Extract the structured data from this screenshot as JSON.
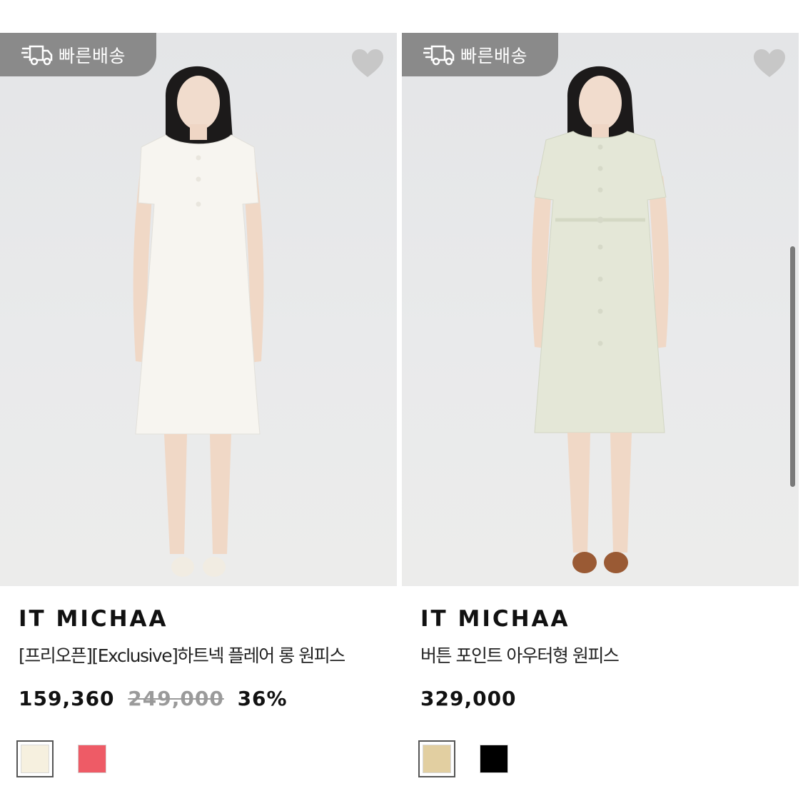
{
  "products": [
    {
      "badge": "빠른배송",
      "brand": "IT MICHAA",
      "name": "[프리오픈][Exclusive]하트넥 플레어 롱 원피스",
      "price": "159,360",
      "original_price": "249,000",
      "discount": "36%",
      "dress_color": "#f7f5f0",
      "shoe_color": "#f1ece2",
      "swatches": [
        {
          "color": "#f6f0df",
          "selected": true
        },
        {
          "color": "#ee5b66",
          "selected": false
        }
      ]
    },
    {
      "badge": "빠른배송",
      "brand": "IT MICHAA",
      "name": "버튼 포인트 아우터형 원피스",
      "price": "329,000",
      "original_price": "",
      "discount": "",
      "dress_color": "#e4e7d7",
      "shoe_color": "#9a5a34",
      "swatches": [
        {
          "color": "#e2cfa1",
          "selected": true
        },
        {
          "color": "#000000",
          "selected": false
        }
      ]
    }
  ],
  "icons": {
    "badge_icon": "delivery-truck-icon",
    "wish_icon": "heart-icon"
  },
  "colors": {
    "badge_bg": "#8a8a8a",
    "heart": "#c7c7c7",
    "photo_bg": "#e7e8e9"
  }
}
